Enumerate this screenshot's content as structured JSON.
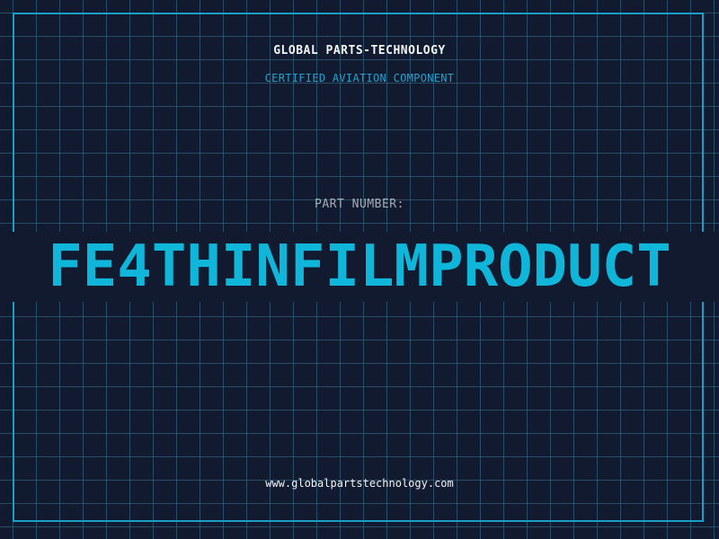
{
  "header": {
    "company": "GLOBAL PARTS-TECHNOLOGY",
    "tagline": "CERTIFIED AVIATION COMPONENT"
  },
  "part": {
    "label": "PART NUMBER:",
    "number": "FE4THINFILMPRODUCT"
  },
  "footer": {
    "website": "www.globalpartstechnology.com"
  },
  "colors": {
    "background": "#111a2e",
    "grid": "#3a7694",
    "frame": "#1b9ec8",
    "accent": "#10b6da",
    "text": "#f2f5f8"
  }
}
